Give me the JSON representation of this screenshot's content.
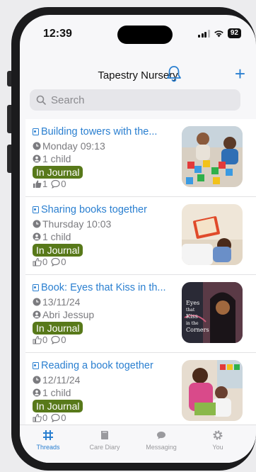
{
  "status_bar": {
    "time": "12:39",
    "battery": "92"
  },
  "header": {
    "title": "Tapestry Nursery",
    "plus_label": "+"
  },
  "search": {
    "placeholder": "Search"
  },
  "observations": [
    {
      "title": "Building towers with the...",
      "date": "Monday 09:13",
      "children": "1 child",
      "status": "In Journal",
      "likes": "1",
      "comments": "0"
    },
    {
      "title": "Sharing books together",
      "date": "Thursday 10:03",
      "children": "1 child",
      "status": "In Journal",
      "likes": "0",
      "comments": "0"
    },
    {
      "title": "Book: Eyes that Kiss in th...",
      "date": "13/11/24",
      "children": "Abri Jessup",
      "status": "In Journal",
      "likes": "0",
      "comments": "0"
    },
    {
      "title": "Reading a book together",
      "date": "12/11/24",
      "children": "1 child",
      "status": "In Journal",
      "likes": "0",
      "comments": "0"
    }
  ],
  "book_cover": {
    "line1": "Eyes",
    "line2": "that",
    "line3": "Kiss",
    "line4": "in the",
    "line5": "Corners"
  },
  "tabs": [
    {
      "label": "Threads",
      "icon": "threads-icon",
      "active": true
    },
    {
      "label": "Care Diary",
      "icon": "book-icon",
      "active": false
    },
    {
      "label": "Messaging",
      "icon": "chat-bubble-icon",
      "active": false
    },
    {
      "label": "You",
      "icon": "gear-icon",
      "active": false
    }
  ],
  "colors": {
    "accent": "#2a7fd0",
    "journal_badge": "#58791a"
  }
}
